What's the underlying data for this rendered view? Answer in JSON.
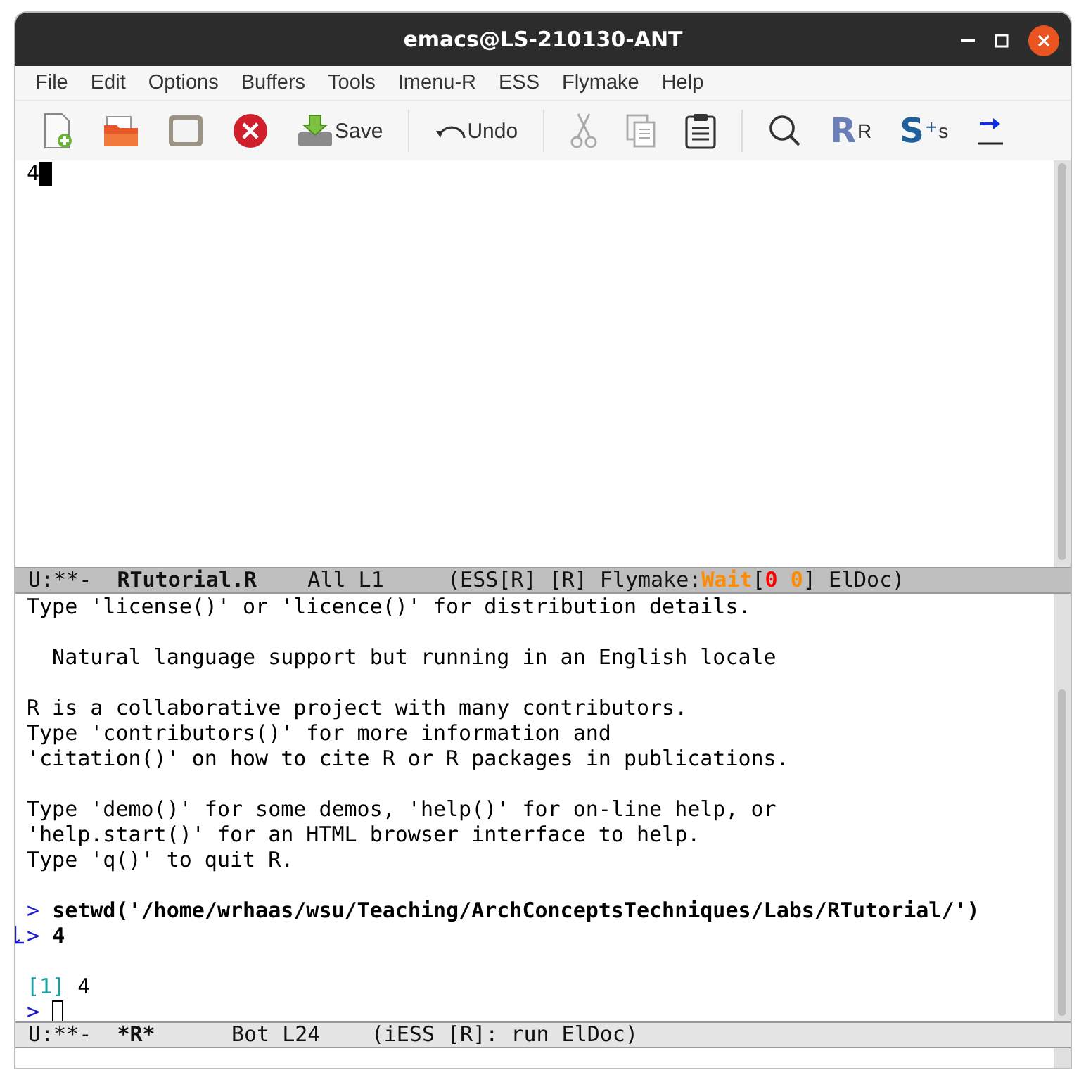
{
  "window": {
    "title": "emacs@LS-210130-ANT"
  },
  "menu": [
    "File",
    "Edit",
    "Options",
    "Buffers",
    "Tools",
    "Imenu-R",
    "ESS",
    "Flymake",
    "Help"
  ],
  "toolbar": [
    {
      "kind": "new"
    },
    {
      "kind": "open"
    },
    {
      "kind": "frame"
    },
    {
      "kind": "close"
    },
    {
      "kind": "save",
      "label": "Save"
    },
    {
      "kind": "sep"
    },
    {
      "kind": "undo",
      "label": "Undo"
    },
    {
      "kind": "sep"
    },
    {
      "kind": "cut",
      "disabled": true
    },
    {
      "kind": "copy",
      "disabled": true
    },
    {
      "kind": "paste",
      "disabled": false
    },
    {
      "kind": "sep"
    },
    {
      "kind": "search"
    },
    {
      "kind": "r",
      "logo": "R",
      "label": "R"
    },
    {
      "kind": "s",
      "logo": "S",
      "mark": "+",
      "label": "s"
    },
    {
      "kind": "goto"
    }
  ],
  "editor": {
    "lines": [
      "4"
    ]
  },
  "mode_line_top": {
    "active": true,
    "segments": [
      {
        "kind": "plain",
        "text": "U:**-  "
      },
      {
        "kind": "bold",
        "text": "RTutorial.R"
      },
      {
        "kind": "plain",
        "text": "    All L1     (ESS[R] [R] Flymake:"
      },
      {
        "kind": "warn",
        "text": "Wait"
      },
      {
        "kind": "plain",
        "text": "["
      },
      {
        "kind": "error",
        "text": "0"
      },
      {
        "kind": "warn",
        "text": " 0"
      },
      {
        "kind": "plain",
        "text": "] ElDoc)"
      }
    ]
  },
  "repl": {
    "lines": [
      {
        "kind": "text",
        "text": "Type 'license()' or 'licence()' for distribution details."
      },
      {
        "kind": "blank"
      },
      {
        "kind": "text",
        "text": "  Natural language support but running in an English locale"
      },
      {
        "kind": "blank"
      },
      {
        "kind": "text",
        "text": "R is a collaborative project with many contributors."
      },
      {
        "kind": "text",
        "text": "Type 'contributors()' for more information and"
      },
      {
        "kind": "text",
        "text": "'citation()' on how to cite R or R packages in publications."
      },
      {
        "kind": "blank"
      },
      {
        "kind": "text",
        "text": "Type 'demo()' for some demos, 'help()' for on-line help, or"
      },
      {
        "kind": "text",
        "text": "'help.start()' for an HTML browser interface to help."
      },
      {
        "kind": "text",
        "text": "Type 'q()' to quit R."
      },
      {
        "kind": "blank"
      },
      {
        "kind": "input",
        "prompt": ">",
        "text": "setwd('/home/wrhaas/wsu/Teaching/ArchConceptsTechniques/Labs/RTutorial/')"
      },
      {
        "kind": "input",
        "prompt": ">",
        "text": "4",
        "wrapped": true
      },
      {
        "kind": "blank"
      },
      {
        "kind": "result",
        "index": "[1]",
        "text": "4"
      },
      {
        "kind": "prompt",
        "prompt": ">"
      }
    ]
  },
  "mode_line_bottom": {
    "active": false,
    "segments": [
      {
        "kind": "plain",
        "text": "U:**-  "
      },
      {
        "kind": "bold",
        "text": "*R*"
      },
      {
        "kind": "plain",
        "text": "      Bot L24    (iESS [R]: run ElDoc)"
      }
    ]
  }
}
